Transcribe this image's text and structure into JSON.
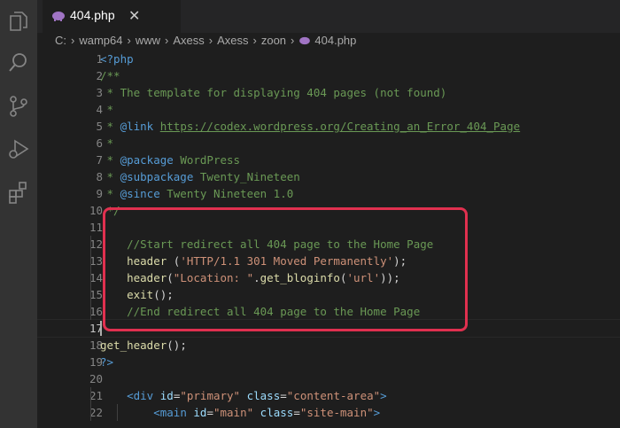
{
  "tab": {
    "label": "404.php",
    "close": "✕"
  },
  "breadcrumb": [
    "C:",
    "wamp64",
    "www",
    "Axess",
    "Axess",
    "zoon",
    "404.php"
  ],
  "breadcrumb_sep": "›",
  "activity_icons": [
    "explorer-icon",
    "search-icon",
    "source-control-icon",
    "run-debug-icon",
    "extensions-icon"
  ],
  "line_numbers": [
    "1",
    "2",
    "3",
    "4",
    "5",
    "6",
    "7",
    "8",
    "9",
    "10",
    "11",
    "12",
    "13",
    "14",
    "15",
    "16",
    "17",
    "18",
    "19",
    "20",
    "21",
    "22"
  ],
  "active_line": "17",
  "lines": [
    [
      {
        "t": "<",
        "c": "c-tag"
      },
      {
        "t": "?php",
        "c": "c-tag"
      }
    ],
    [
      {
        "t": "/**",
        "c": "c-comment"
      }
    ],
    [
      {
        "t": " * The template for displaying 404 pages (not found)",
        "c": "c-comment"
      }
    ],
    [
      {
        "t": " *",
        "c": "c-comment"
      }
    ],
    [
      {
        "t": " * ",
        "c": "c-comment"
      },
      {
        "t": "@link",
        "c": "c-doc"
      },
      {
        "t": " ",
        "c": "c-comment"
      },
      {
        "t": "https://codex.wordpress.org/Creating_an_Error_404_Page",
        "c": "c-link"
      }
    ],
    [
      {
        "t": " *",
        "c": "c-comment"
      }
    ],
    [
      {
        "t": " * ",
        "c": "c-comment"
      },
      {
        "t": "@package",
        "c": "c-doc"
      },
      {
        "t": " WordPress",
        "c": "c-comment"
      }
    ],
    [
      {
        "t": " * ",
        "c": "c-comment"
      },
      {
        "t": "@subpackage",
        "c": "c-doc"
      },
      {
        "t": " Twenty_Nineteen",
        "c": "c-comment"
      }
    ],
    [
      {
        "t": " * ",
        "c": "c-comment"
      },
      {
        "t": "@since",
        "c": "c-doc"
      },
      {
        "t": " Twenty Nineteen 1.0",
        "c": "c-comment"
      }
    ],
    [
      {
        "t": " */",
        "c": "c-comment"
      }
    ],
    [],
    [
      {
        "t": "    //Start redirect all 404 page to the Home Page",
        "c": "c-comment"
      }
    ],
    [
      {
        "t": "    ",
        "c": ""
      },
      {
        "t": "header",
        "c": "c-fn"
      },
      {
        "t": " (",
        "c": ""
      },
      {
        "t": "'HTTP/1.1 301 Moved Permanently'",
        "c": "c-str"
      },
      {
        "t": ");",
        "c": ""
      }
    ],
    [
      {
        "t": "    ",
        "c": ""
      },
      {
        "t": "header",
        "c": "c-fn"
      },
      {
        "t": "(",
        "c": ""
      },
      {
        "t": "\"Location: \"",
        "c": "c-str"
      },
      {
        "t": ".",
        "c": ""
      },
      {
        "t": "get_bloginfo",
        "c": "c-fn"
      },
      {
        "t": "(",
        "c": ""
      },
      {
        "t": "'url'",
        "c": "c-str"
      },
      {
        "t": "));",
        "c": ""
      }
    ],
    [
      {
        "t": "    ",
        "c": ""
      },
      {
        "t": "exit",
        "c": "c-fn"
      },
      {
        "t": "();",
        "c": ""
      }
    ],
    [
      {
        "t": "    //End redirect all 404 page to the Home Page",
        "c": "c-comment"
      }
    ],
    [],
    [
      {
        "t": "get_header",
        "c": "c-fn"
      },
      {
        "t": "();",
        "c": ""
      }
    ],
    [
      {
        "t": "?>",
        "c": "c-tag"
      }
    ],
    [],
    [
      {
        "t": "    ",
        "c": ""
      },
      {
        "t": "<div",
        "c": "c-tag"
      },
      {
        "t": " ",
        "c": ""
      },
      {
        "t": "id",
        "c": "c-attr"
      },
      {
        "t": "=",
        "c": ""
      },
      {
        "t": "\"primary\"",
        "c": "c-str"
      },
      {
        "t": " ",
        "c": ""
      },
      {
        "t": "class",
        "c": "c-attr"
      },
      {
        "t": "=",
        "c": ""
      },
      {
        "t": "\"content-area\"",
        "c": "c-str"
      },
      {
        "t": ">",
        "c": "c-tag"
      }
    ],
    [
      {
        "t": "        ",
        "c": ""
      },
      {
        "t": "<main",
        "c": "c-tag"
      },
      {
        "t": " ",
        "c": ""
      },
      {
        "t": "id",
        "c": "c-attr"
      },
      {
        "t": "=",
        "c": ""
      },
      {
        "t": "\"main\"",
        "c": "c-str"
      },
      {
        "t": " ",
        "c": ""
      },
      {
        "t": "class",
        "c": "c-attr"
      },
      {
        "t": "=",
        "c": ""
      },
      {
        "t": "\"site-main\"",
        "c": "c-str"
      },
      {
        "t": ">",
        "c": "c-tag"
      }
    ]
  ],
  "colors": {
    "highlight_border": "#e0304f",
    "php_icon": "#a074c4"
  }
}
